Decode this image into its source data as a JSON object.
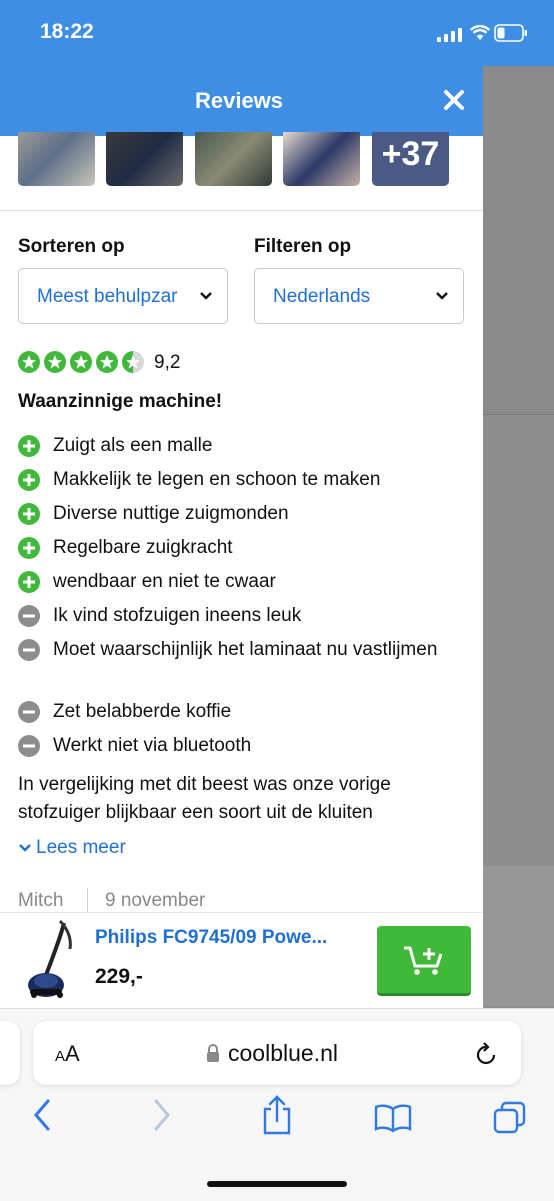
{
  "status": {
    "time": "18:22"
  },
  "modal": {
    "title": "Reviews"
  },
  "gallery": {
    "more_count": "+37"
  },
  "sort": {
    "label": "Sorteren op",
    "value": "Meest behulpzar"
  },
  "filter": {
    "label": "Filteren op",
    "value": "Nederlands"
  },
  "review": {
    "score": "9,2",
    "stars": 4.5,
    "title": "Waanzinnige machine!",
    "pros": [
      "Zuigt als een malle",
      "Makkelijk te legen en schoon te maken",
      "Diverse nuttige zuigmonden",
      "Regelbare zuigkracht",
      "wendbaar en niet te cwaar"
    ],
    "cons": [
      "Ik vind stofzuigen ineens leuk",
      "Moet waarschijnlijk het laminaat nu vastlijmen",
      "Zet belabberde koffie",
      "Werkt niet via bluetooth"
    ],
    "body": "In vergelijking met dit beest was onze vorige stofzuiger blijkbaar een soort uit de kluiten",
    "read_more": "Lees meer",
    "author": "Mitch",
    "date": "9 november"
  },
  "product": {
    "name": "Philips FC9745/09 Powe...",
    "price": "229,-"
  },
  "browser": {
    "aa": "AA",
    "url": "coolblue.nl"
  },
  "colors": {
    "brand_blue": "#3e8ee6",
    "pro_green": "#40b83a",
    "con_grey": "#8c8c8c",
    "link_blue": "#1f6fd6"
  }
}
